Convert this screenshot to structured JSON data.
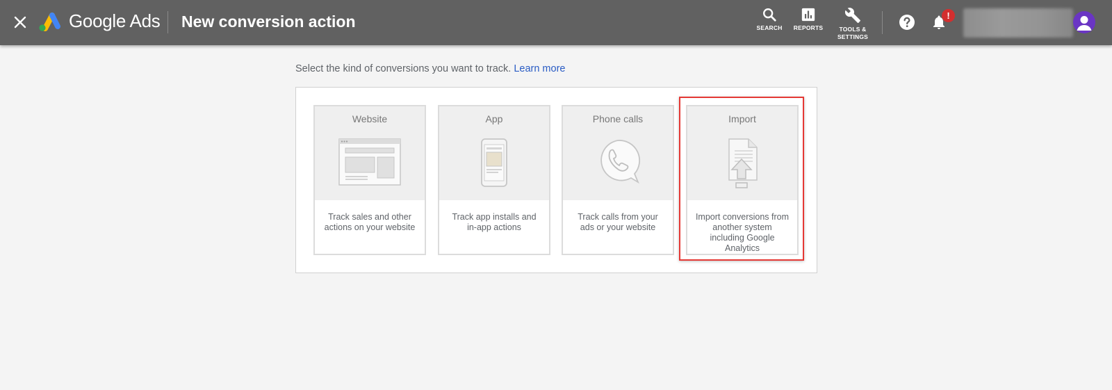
{
  "header": {
    "brand": "Google Ads",
    "title": "New conversion action",
    "nav": {
      "search": "SEARCH",
      "reports": "REPORTS",
      "tools_line1": "TOOLS &",
      "tools_line2": "SETTINGS"
    },
    "notification_badge": "!",
    "icons": [
      "close-icon",
      "google-ads-logo",
      "search-icon",
      "reports-icon",
      "wrench-icon",
      "help-icon",
      "bell-icon",
      "avatar-icon"
    ],
    "colors": {
      "bar": "#616161",
      "badge": "#d32f2f",
      "avatar": "#6a35c4"
    }
  },
  "content": {
    "intro": "Select the kind of conversions you want to track.",
    "learn_more": "Learn more",
    "link_color": "#2a5cc4",
    "highlight_color": "#e53935",
    "cards": [
      {
        "title": "Website",
        "description": "Track sales and other actions on your website",
        "icon": "website-icon"
      },
      {
        "title": "App",
        "description": "Track app installs and in-app actions",
        "icon": "phone-app-icon"
      },
      {
        "title": "Phone calls",
        "description": "Track calls from your ads or your website",
        "icon": "phone-call-icon"
      },
      {
        "title": "Import",
        "description": "Import conversions from another system including Google Analytics",
        "icon": "import-icon"
      }
    ]
  }
}
